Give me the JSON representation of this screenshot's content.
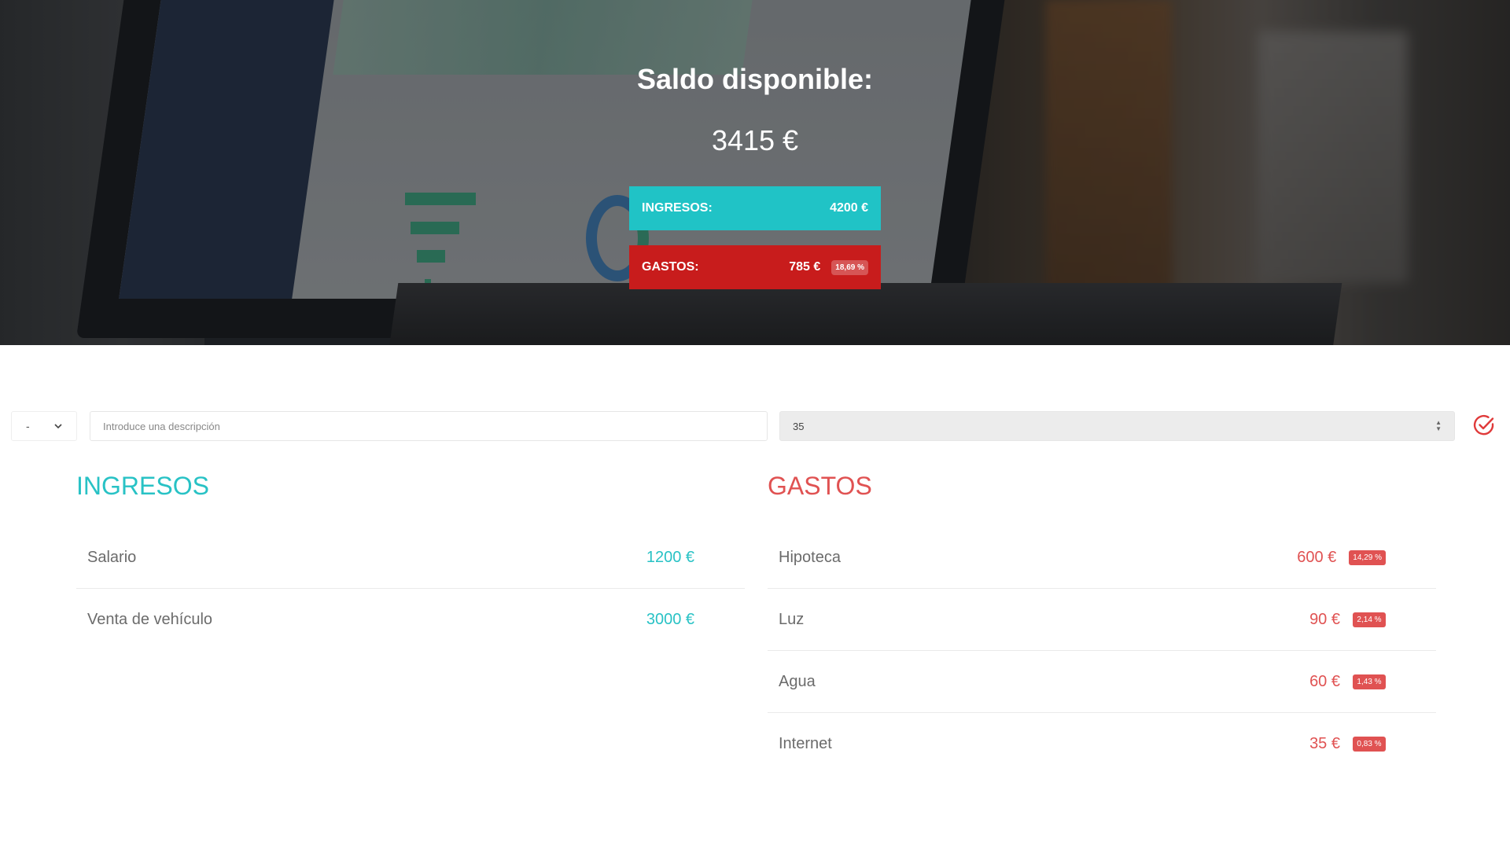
{
  "header": {
    "title": "Saldo disponible:",
    "balance": "3415 €",
    "income_label": "INGRESOS:",
    "income_value": "4200 €",
    "expense_label": "GASTOS:",
    "expense_value": "785 €",
    "expense_percentage": "18,69 %"
  },
  "form": {
    "type_selected": "-",
    "description_placeholder": "Introduce una descripción",
    "value": "35"
  },
  "income": {
    "title": "INGRESOS",
    "items": [
      {
        "description": "Salario",
        "value": "1200 €"
      },
      {
        "description": "Venta de vehículo",
        "value": "3000 €"
      }
    ]
  },
  "expenses": {
    "title": "GASTOS",
    "items": [
      {
        "description": "Hipoteca",
        "value": "600 €",
        "percentage": "14,29 %"
      },
      {
        "description": "Luz",
        "value": "90 €",
        "percentage": "2,14 %"
      },
      {
        "description": "Agua",
        "value": "60 €",
        "percentage": "1,43 %"
      },
      {
        "description": "Internet",
        "value": "35 €",
        "percentage": "0,83 %"
      }
    ]
  },
  "colors": {
    "income": "#28c2c5",
    "expense": "#e05252",
    "income_box": "#20c3c6",
    "expense_box": "#c81c1c"
  },
  "icons": {
    "submit": "check-circle-icon",
    "select_arrow": "chevron-down-icon",
    "spinner": "spinner-arrows-icon"
  }
}
